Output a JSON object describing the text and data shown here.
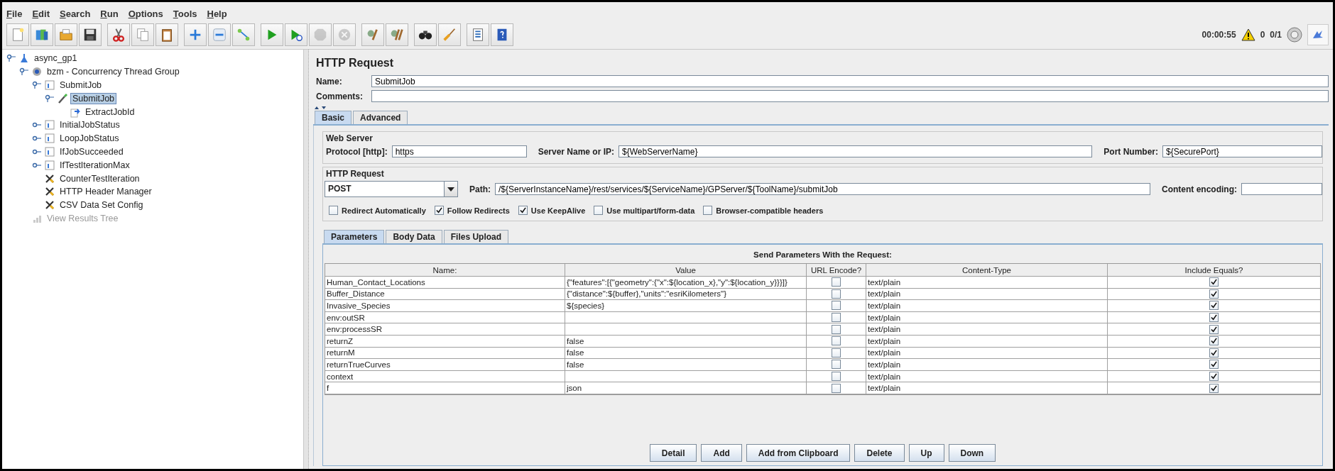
{
  "menu": [
    "File",
    "Edit",
    "Search",
    "Run",
    "Options",
    "Tools",
    "Help"
  ],
  "toolbar": [
    [
      {
        "kind": "new",
        "disabled": false
      },
      {
        "kind": "templates",
        "disabled": false
      },
      {
        "kind": "open",
        "disabled": false
      },
      {
        "kind": "save",
        "disabled": false
      }
    ],
    [
      {
        "kind": "cut",
        "disabled": false
      },
      {
        "kind": "copy",
        "disabled": false
      },
      {
        "kind": "paste",
        "disabled": false
      }
    ],
    [
      {
        "kind": "expand",
        "disabled": false
      },
      {
        "kind": "collapse",
        "disabled": false
      },
      {
        "kind": "toggle",
        "disabled": false
      }
    ],
    [
      {
        "kind": "start",
        "disabled": false
      },
      {
        "kind": "start_no_timers",
        "disabled": false
      },
      {
        "kind": "stop",
        "disabled": true
      },
      {
        "kind": "shutdown",
        "disabled": true
      }
    ],
    [
      {
        "kind": "clear",
        "disabled": false
      },
      {
        "kind": "clear_all",
        "disabled": false
      }
    ],
    [
      {
        "kind": "search",
        "disabled": false
      },
      {
        "kind": "reset_search",
        "disabled": false
      }
    ],
    [
      {
        "kind": "function_helper",
        "disabled": false
      },
      {
        "kind": "help",
        "disabled": false
      }
    ]
  ],
  "status": {
    "elapsed": "00:00:55",
    "warnings": "0",
    "threads": "0/1"
  },
  "tree": [
    {
      "label": "async_gp1",
      "kind": "test_plan",
      "expanded": true,
      "selected": false,
      "disabled": false,
      "children": [
        {
          "label": "bzm - Concurrency Thread Group",
          "kind": "thread_group",
          "expanded": true,
          "selected": false,
          "disabled": false,
          "children": [
            {
              "label": "SubmitJob",
              "kind": "controller",
              "expanded": true,
              "selected": false,
              "disabled": false,
              "children": [
                {
                  "label": "SubmitJob",
                  "kind": "sampler",
                  "expanded": true,
                  "selected": true,
                  "disabled": false,
                  "children": [
                    {
                      "label": "ExtractJobId",
                      "kind": "extractor",
                      "selected": false,
                      "disabled": false
                    }
                  ]
                }
              ]
            },
            {
              "label": "InitialJobStatus",
              "kind": "controller",
              "expanded": false,
              "selected": false,
              "disabled": false
            },
            {
              "label": "LoopJobStatus",
              "kind": "controller",
              "expanded": false,
              "selected": false,
              "disabled": false
            },
            {
              "label": "IfJobSucceeded",
              "kind": "controller",
              "expanded": false,
              "selected": false,
              "disabled": false
            },
            {
              "label": "IfTestIterationMax",
              "kind": "controller",
              "expanded": false,
              "selected": false,
              "disabled": false
            },
            {
              "label": "CounterTestIteration",
              "kind": "config",
              "selected": false,
              "disabled": false
            },
            {
              "label": "HTTP Header Manager",
              "kind": "config",
              "selected": false,
              "disabled": false
            },
            {
              "label": "CSV Data Set Config",
              "kind": "config",
              "selected": false,
              "disabled": false
            }
          ]
        },
        {
          "label": "View Results Tree",
          "kind": "listener",
          "selected": false,
          "disabled": true
        }
      ]
    }
  ],
  "panel": {
    "title": "HTTP Request",
    "name_label": "Name:",
    "name": "SubmitJob",
    "comments_label": "Comments:"
  },
  "tabs": [
    {
      "label": "Basic",
      "selected": true
    },
    {
      "label": "Advanced",
      "selected": false
    }
  ],
  "web_server": {
    "title": "Web Server",
    "protocol_label": "Protocol [http]:",
    "protocol": "https",
    "server_label": "Server Name or IP:",
    "server": "${WebServerName}",
    "port_label": "Port Number:",
    "port": "${SecurePort}"
  },
  "http_request": {
    "title": "HTTP Request",
    "method": "POST",
    "path_label": "Path:",
    "path": "/${ServerInstanceName}/rest/services/${ServiceName}/GPServer/${ToolName}/submitJob",
    "encoding_label": "Content encoding:"
  },
  "options": [
    {
      "label": "Redirect Automatically",
      "checked": false
    },
    {
      "label": "Follow Redirects",
      "checked": true
    },
    {
      "label": "Use KeepAlive",
      "checked": true
    },
    {
      "label": "Use multipart/form-data",
      "checked": false
    },
    {
      "label": "Browser-compatible headers",
      "checked": false
    }
  ],
  "param_tabs": [
    {
      "label": "Parameters",
      "selected": true
    },
    {
      "label": "Body Data",
      "selected": false
    },
    {
      "label": "Files Upload",
      "selected": false
    }
  ],
  "table": {
    "title": "Send Parameters With the Request:",
    "columns": [
      "Name:",
      "Value",
      "URL Encode?",
      "Content-Type",
      "Include Equals?"
    ],
    "rows": [
      {
        "name": "Human_Contact_Locations",
        "value": "{\"features\":[{\"geometry\":{\"x\":${location_x},\"y\":${location_y}}}]}",
        "url_encode": false,
        "content_type": "text/plain",
        "include_equals": true
      },
      {
        "name": "Buffer_Distance",
        "value": "{\"distance\":${buffer},\"units\":\"esriKilometers\"}",
        "url_encode": false,
        "content_type": "text/plain",
        "include_equals": true
      },
      {
        "name": "Invasive_Species",
        "value": "${species}",
        "url_encode": false,
        "content_type": "text/plain",
        "include_equals": true
      },
      {
        "name": "env:outSR",
        "value": "",
        "url_encode": false,
        "content_type": "text/plain",
        "include_equals": true
      },
      {
        "name": "env:processSR",
        "value": "",
        "url_encode": false,
        "content_type": "text/plain",
        "include_equals": true
      },
      {
        "name": "returnZ",
        "value": "false",
        "url_encode": false,
        "content_type": "text/plain",
        "include_equals": true
      },
      {
        "name": "returnM",
        "value": "false",
        "url_encode": false,
        "content_type": "text/plain",
        "include_equals": true
      },
      {
        "name": "returnTrueCurves",
        "value": "false",
        "url_encode": false,
        "content_type": "text/plain",
        "include_equals": true
      },
      {
        "name": "context",
        "value": "",
        "url_encode": false,
        "content_type": "text/plain",
        "include_equals": true
      },
      {
        "name": "f",
        "value": "json",
        "url_encode": false,
        "content_type": "text/plain",
        "include_equals": true
      }
    ]
  },
  "buttons": [
    "Detail",
    "Add",
    "Add from Clipboard",
    "Delete",
    "Up",
    "Down"
  ]
}
